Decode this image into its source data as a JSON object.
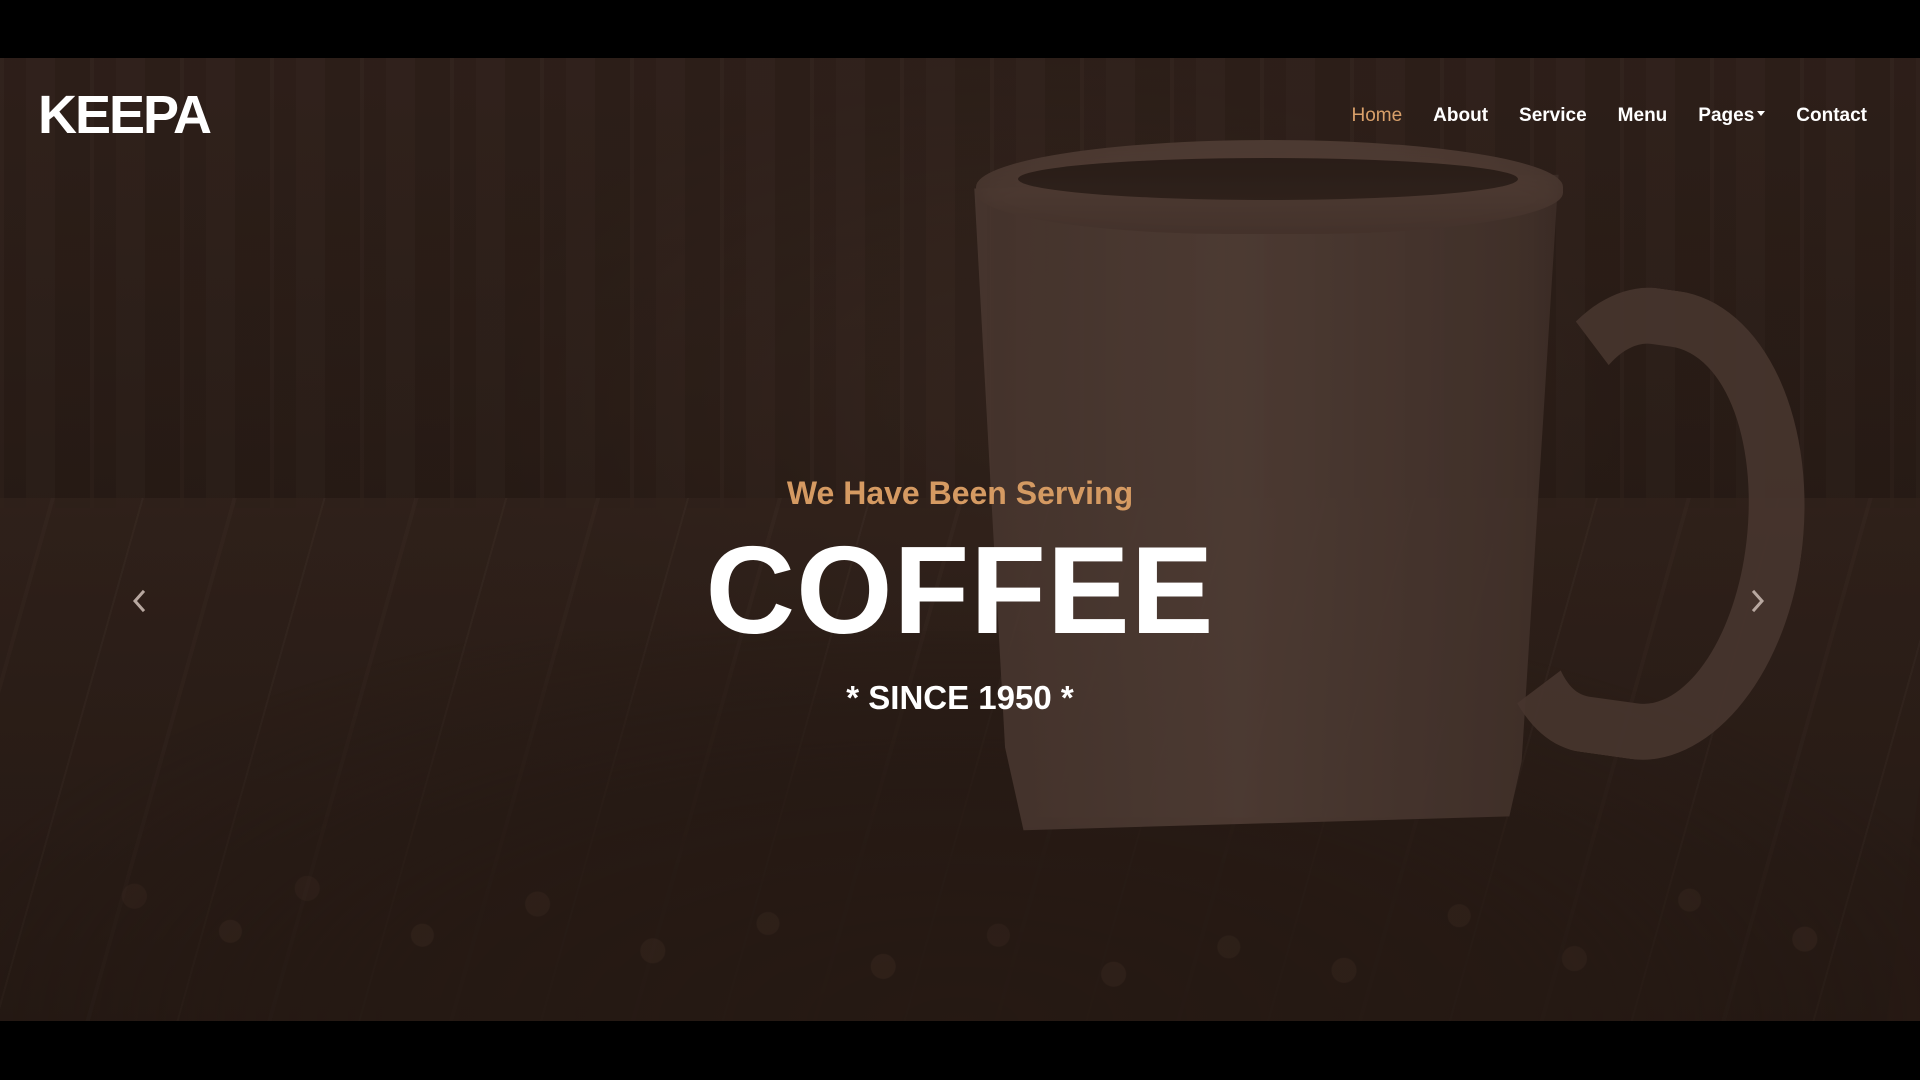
{
  "brand": {
    "logo": "KEEPA"
  },
  "navigation": {
    "items": [
      {
        "label": "Home",
        "active": true
      },
      {
        "label": "About",
        "active": false
      },
      {
        "label": "Service",
        "active": false
      },
      {
        "label": "Menu",
        "active": false
      },
      {
        "label": "Pages",
        "active": false,
        "has_dropdown": true
      },
      {
        "label": "Contact",
        "active": false
      }
    ]
  },
  "hero": {
    "eyebrow": "We Have Been Serving",
    "headline": "COFFEE",
    "since": "* SINCE 1950 *"
  },
  "carousel": {
    "previous_icon": "chevron-left-icon",
    "next_icon": "chevron-right-icon"
  },
  "colors": {
    "accent": "#d9a06a",
    "text": "#ffffff"
  }
}
